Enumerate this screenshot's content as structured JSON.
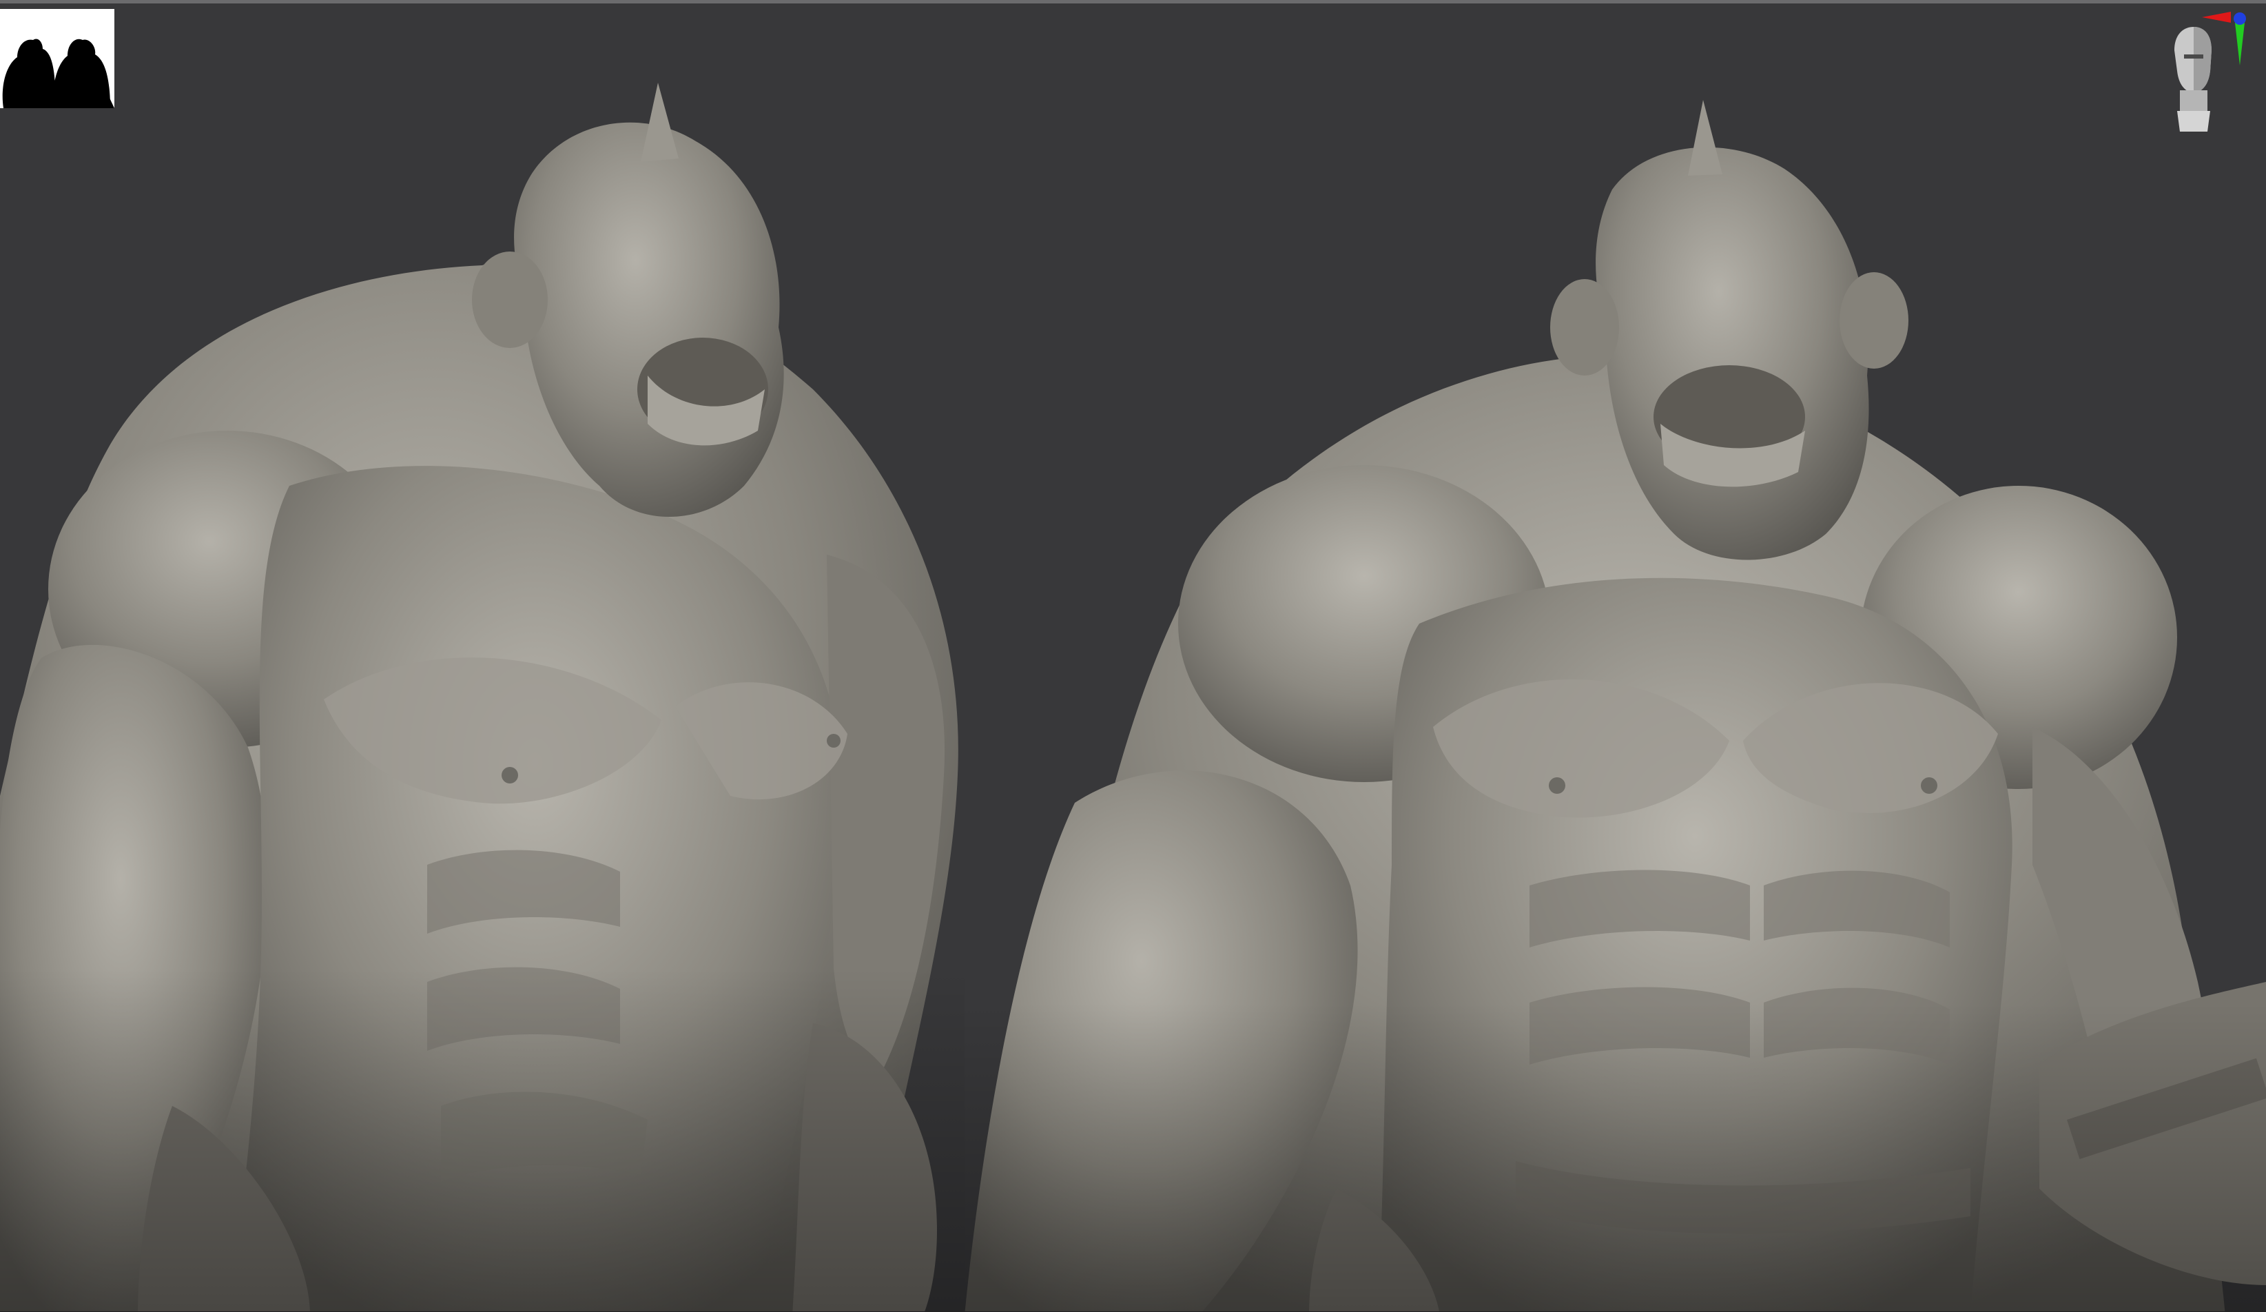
{
  "viewport": {
    "background_color": "#38383a",
    "model_color": "#8a877f",
    "model_shadow_color": "#5a5853",
    "model_highlight_color": "#b4b1a9"
  },
  "thumbnail": {
    "icon": "silhouette-thumbnail-icon",
    "background_color": "#ffffff",
    "silhouette_color": "#000000"
  },
  "navigation_gizmo": {
    "icon": "head-orientation-gizmo-icon",
    "axis_colors": {
      "x": "#e01818",
      "y": "#22cc22",
      "z": "#2040e0"
    }
  }
}
